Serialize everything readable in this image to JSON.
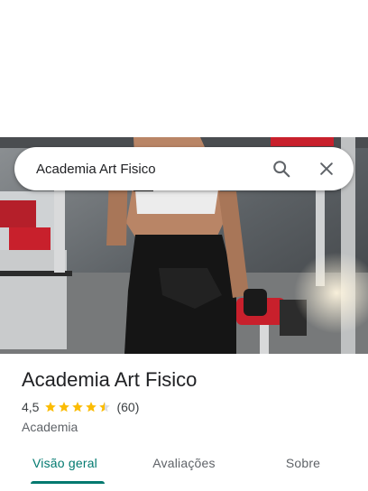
{
  "search": {
    "query": "Academia Art Fisico"
  },
  "icons": {
    "search": "search-icon",
    "close": "close-icon",
    "star": "star-icon"
  },
  "place": {
    "title": "Academia Art Fisico",
    "rating": "4,5",
    "rating_value": 4.5,
    "review_count": "(60)",
    "category": "Academia"
  },
  "tabs": [
    {
      "label": "Visão geral",
      "active": true
    },
    {
      "label": "Avaliações",
      "active": false
    },
    {
      "label": "Sobre",
      "active": false
    }
  ],
  "colors": {
    "accent": "#01796f",
    "star": "#fbbc04"
  }
}
